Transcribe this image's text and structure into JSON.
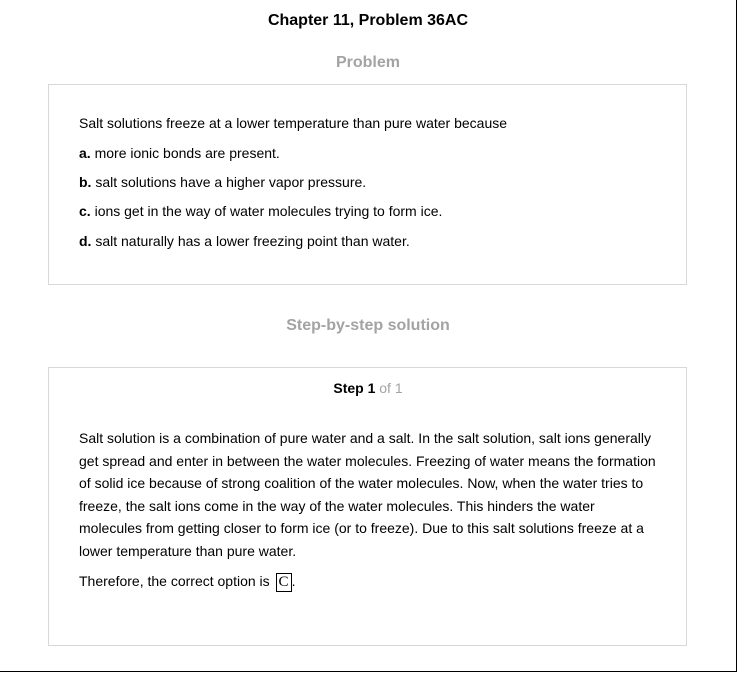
{
  "chapter_title": "Chapter 11, Problem 36AC",
  "problem": {
    "heading": "Problem",
    "question": "Salt solutions freeze at a lower temperature than pure water because",
    "options": [
      {
        "letter": "a.",
        "text": " more ionic bonds are present."
      },
      {
        "letter": "b.",
        "text": " salt solutions have a higher vapor pressure."
      },
      {
        "letter": "c.",
        "text": " ions get in the way of water molecules trying to form ice."
      },
      {
        "letter": "d.",
        "text": " salt naturally has a lower freezing point than water."
      }
    ]
  },
  "solution": {
    "heading": "Step-by-step solution",
    "step_word": "Step 1",
    "step_of": " of 1",
    "explanation": "Salt solution is a combination of pure water and a salt. In the salt solution, salt ions generally get spread and enter in between the water molecules. Freezing of water means the formation of solid ice because of strong coalition of the water molecules. Now, when the water tries to freeze, the salt ions come in the way of the water molecules. This hinders the water molecules from getting closer to form ice (or to freeze). Due to this salt solutions freeze at a lower temperature than pure water.",
    "answer_prefix": "Therefore, the correct option is ",
    "answer": "C",
    "answer_suffix": "."
  }
}
